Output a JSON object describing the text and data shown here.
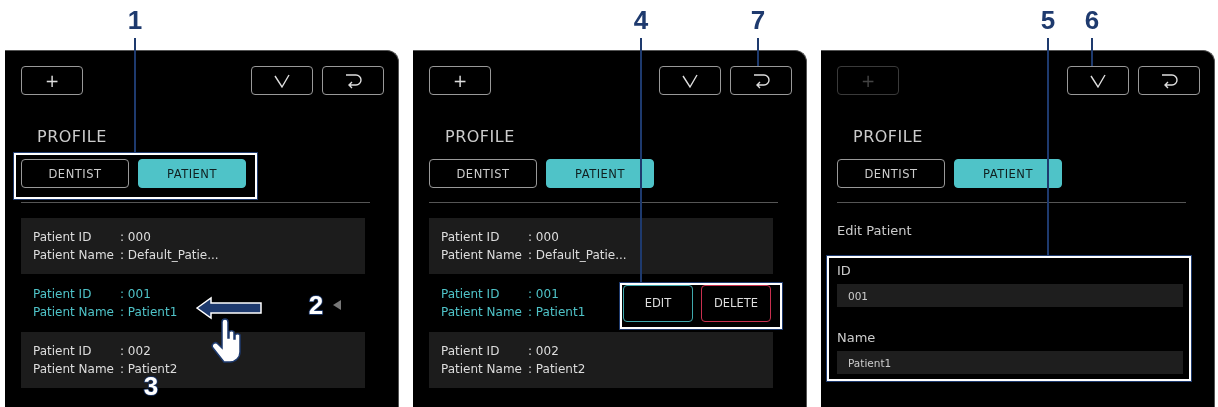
{
  "panels": [
    {
      "toolbar": {
        "add": {
          "label": "+",
          "disabled": false
        }
      },
      "profile": {
        "title": "PROFILE",
        "tabs": [
          {
            "label": "DENTIST",
            "selected": false
          },
          {
            "label": "PATIENT",
            "selected": true
          }
        ]
      },
      "patients": [
        {
          "id_label": "Patient ID",
          "id": ": 000",
          "name_label": "Patient Name",
          "name": ": Default_Patie...",
          "selected": false
        },
        {
          "id_label": "Patient ID",
          "id": ": 001",
          "name_label": "Patient Name",
          "name": ": Patient1",
          "selected": true,
          "swiping": true
        },
        {
          "id_label": "Patient ID",
          "id": ": 002",
          "name_label": "Patient Name",
          "name": ": Patient2",
          "selected": false
        }
      ],
      "callouts": [
        {
          "label": "1",
          "kind": "leader"
        },
        {
          "label": "2",
          "kind": "marker"
        },
        {
          "label": "3",
          "kind": "marker"
        }
      ]
    },
    {
      "toolbar": {
        "add": {
          "label": "+",
          "disabled": false
        }
      },
      "profile": {
        "title": "PROFILE",
        "tabs": [
          {
            "label": "DENTIST",
            "selected": false
          },
          {
            "label": "PATIENT",
            "selected": true
          }
        ]
      },
      "patients": [
        {
          "id_label": "Patient ID",
          "id": ": 000",
          "name_label": "Patient Name",
          "name": ": Default_Patie...",
          "selected": false
        },
        {
          "id_label": "Patient ID",
          "id": ": 001",
          "name_label": "Patient Name",
          "name": ": Patient1",
          "selected": true,
          "actions": [
            {
              "label": "EDIT",
              "kind": "edit"
            },
            {
              "label": "DELETE",
              "kind": "delete"
            }
          ]
        },
        {
          "id_label": "Patient ID",
          "id": ": 002",
          "name_label": "Patient Name",
          "name": ": Patient2",
          "selected": false
        }
      ],
      "callouts": [
        {
          "label": "4",
          "kind": "leader"
        },
        {
          "label": "7",
          "kind": "leader"
        }
      ]
    },
    {
      "toolbar": {
        "add": {
          "label": "+",
          "disabled": true
        }
      },
      "profile": {
        "title": "PROFILE",
        "tabs": [
          {
            "label": "DENTIST",
            "selected": false
          },
          {
            "label": "PATIENT",
            "selected": true
          }
        ]
      },
      "form": {
        "title": "Edit Patient",
        "fields": [
          {
            "label": "ID",
            "value": "001"
          },
          {
            "label": "Name",
            "value": "Patient1"
          }
        ]
      },
      "callouts": [
        {
          "label": "5",
          "kind": "leader"
        },
        {
          "label": "6",
          "kind": "leader"
        }
      ]
    }
  ]
}
